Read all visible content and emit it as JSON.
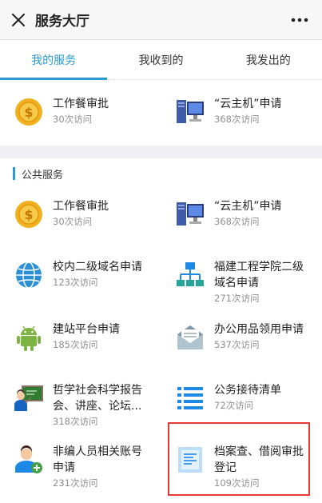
{
  "header": {
    "title": "服务大厅",
    "close_icon": "close-icon",
    "more_icon": "more-dots-icon"
  },
  "tabs": [
    {
      "label": "我的服务",
      "active": true
    },
    {
      "label": "我收到的",
      "active": false
    },
    {
      "label": "我发出的",
      "active": false
    }
  ],
  "my_services": [
    {
      "name": "工作餐审批",
      "visits": "30次访问",
      "icon": "coin-icon"
    },
    {
      "name": "“云主机”申请",
      "visits": "368次访问",
      "icon": "computer-icon"
    }
  ],
  "public_services": {
    "title": "公共服务",
    "items": [
      {
        "name": "工作餐审批",
        "visits": "30次访问",
        "icon": "coin-icon"
      },
      {
        "name": "“云主机”申请",
        "visits": "368次访问",
        "icon": "computer-icon"
      },
      {
        "name": "校内二级域名申请",
        "visits": "123次访问",
        "icon": "globe-icon"
      },
      {
        "name1": "福建工程学院二级",
        "name2": "域名申请",
        "visits": "271次访问",
        "icon": "network-icon"
      },
      {
        "name": "建站平台申请",
        "visits": "185次访问",
        "icon": "android-icon"
      },
      {
        "name": "办公用品领用申请",
        "visits": "537次访问",
        "icon": "mail-icon"
      },
      {
        "name1": "哲学社会科学报告",
        "name2": "会、讲座、论坛...",
        "visits": "318次访问",
        "icon": "lecture-icon"
      },
      {
        "name": "公务接待清单",
        "visits": "72次访问",
        "icon": "list-icon"
      },
      {
        "name1": "非编人员相关账号",
        "name2": "申请",
        "visits": "231次访问",
        "icon": "user-add-icon"
      },
      {
        "name1": "档案查、借阅审批",
        "name2": "登记",
        "visits": "109次访问",
        "icon": "document-icon"
      }
    ]
  },
  "colors": {
    "accent": "#2a9ad6",
    "highlight": "#e53935"
  }
}
